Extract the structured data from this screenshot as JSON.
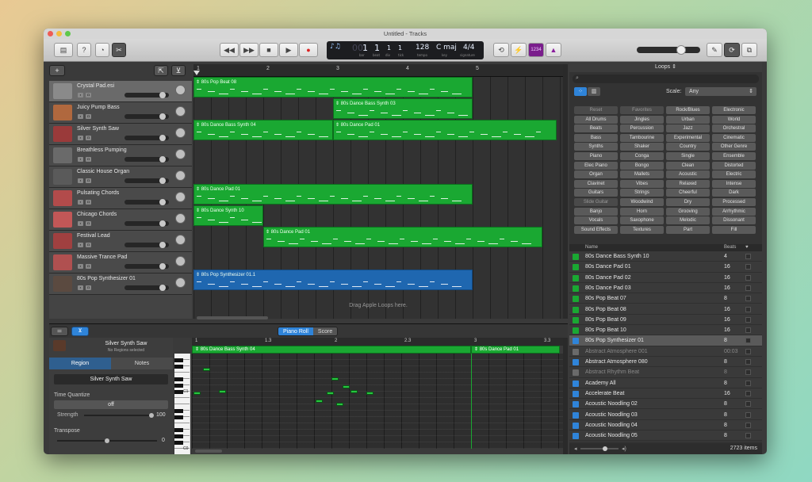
{
  "window": {
    "title": "Untitled - Tracks"
  },
  "lcd": {
    "bar": "1",
    "bar_label": "bar",
    "beat": "1",
    "beat_label": "beat",
    "div": "1",
    "div_label": "div",
    "tick": "1",
    "tick_label": "tick",
    "tempo": "128",
    "tempo_label": "tempo",
    "key": "C maj",
    "key_label": "key",
    "signature": "4/4",
    "signature_label": "signature",
    "counter": "1234"
  },
  "tracks": [
    {
      "name": "Crystal Pad.esi",
      "selected": true
    },
    {
      "name": "Juicy Pump Bass"
    },
    {
      "name": "Silver Synth Saw"
    },
    {
      "name": "Breathless Pumping"
    },
    {
      "name": "Classic House Organ"
    },
    {
      "name": "Pulsating Chords"
    },
    {
      "name": "Chicago Chords"
    },
    {
      "name": "Festival Lead"
    },
    {
      "name": "Massive Trance Pad"
    },
    {
      "name": "80s Pop Synthesizer 01"
    }
  ],
  "ruler": [
    "1",
    "2",
    "3",
    "4",
    "5"
  ],
  "regions": [
    {
      "label": "80s Pop Beat 08",
      "row": 0,
      "start": 0,
      "len": 4
    },
    {
      "label": "80s Dance Bass Synth 03",
      "row": 1,
      "start": 2,
      "len": 2
    },
    {
      "label": "80s Dance Bass Synth 04",
      "row": 2,
      "start": 0,
      "len": 2
    },
    {
      "label": "80s Dance Pad 01",
      "row": 2,
      "start": 2,
      "len": 3.2
    },
    {
      "label": "80s Dance Pad 01",
      "row": 5,
      "start": 0,
      "len": 4
    },
    {
      "label": "80s Dance Synth 10",
      "row": 6,
      "start": 0,
      "len": 1
    },
    {
      "label": "80s Dance Pad 01",
      "row": 7,
      "start": 1,
      "len": 4
    },
    {
      "label": "80s Pop Synthesizer 01.1",
      "row": 9,
      "start": 0,
      "len": 4,
      "color": "blue"
    }
  ],
  "drop_hint": "Drag Apple Loops here.",
  "editor": {
    "tabs": [
      "Piano Roll",
      "Score"
    ],
    "track_name": "Silver Synth Saw",
    "sub": "No Regions selected",
    "inspector_tabs": [
      "Region",
      "Notes"
    ],
    "region_name": "Silver Synth Saw",
    "time_quantize_label": "Time Quantize",
    "time_quantize_value": "off",
    "strength_label": "Strength",
    "strength_value": "100",
    "transpose_label": "Transpose",
    "transpose_value": "0",
    "ruler": [
      "1",
      "1.3",
      "2",
      "2.3",
      "3",
      "3.3"
    ],
    "regions": [
      "80s Dance Bass Synth 04",
      "80s Dance Pad 01"
    ],
    "key_labels": [
      "C1",
      "C0"
    ]
  },
  "loops": {
    "title": "Loops",
    "scale_label": "Scale:",
    "scale_value": "Any",
    "filters": [
      [
        "Reset",
        "Favorites",
        "Rock/Blues",
        "Electronic"
      ],
      [
        "All Drums",
        "Jingles",
        "Urban",
        "World"
      ],
      [
        "Beats",
        "Percussion",
        "Jazz",
        "Orchestral"
      ],
      [
        "Bass",
        "Tambourine",
        "Experimental",
        "Cinematic"
      ],
      [
        "Synths",
        "Shaker",
        "Country",
        "Other Genre"
      ],
      [
        "Piano",
        "Conga",
        "Single",
        "Ensemble"
      ],
      [
        "Elec Piano",
        "Bongo",
        "Clean",
        "Distorted"
      ],
      [
        "Organ",
        "Mallets",
        "Acoustic",
        "Electric"
      ],
      [
        "Clavinet",
        "Vibes",
        "Relaxed",
        "Intense"
      ],
      [
        "Guitars",
        "Strings",
        "Cheerful",
        "Dark"
      ],
      [
        "Slide Guitar",
        "Woodwind",
        "Dry",
        "Processed"
      ],
      [
        "Banjo",
        "Horn",
        "Grooving",
        "Arrhythmic"
      ],
      [
        "Vocals",
        "Saxophone",
        "Melodic",
        "Dissonant"
      ],
      [
        "Sound Effects",
        "Textures",
        "Part",
        "Fill"
      ]
    ],
    "col_name": "Name",
    "col_beats": "Beats",
    "results": [
      {
        "name": "80s Dance Bass Synth 10",
        "beats": "4",
        "kind": "green"
      },
      {
        "name": "80s Dance Pad 01",
        "beats": "16",
        "kind": "green"
      },
      {
        "name": "80s Dance Pad 02",
        "beats": "16",
        "kind": "green"
      },
      {
        "name": "80s Dance Pad 03",
        "beats": "16",
        "kind": "green"
      },
      {
        "name": "80s Pop Beat 07",
        "beats": "8",
        "kind": "green"
      },
      {
        "name": "80s Pop Beat 08",
        "beats": "16",
        "kind": "green"
      },
      {
        "name": "80s Pop Beat 09",
        "beats": "16",
        "kind": "green"
      },
      {
        "name": "80s Pop Beat 10",
        "beats": "16",
        "kind": "green"
      },
      {
        "name": "80s Pop Synthesizer 01",
        "beats": "8",
        "kind": "blue",
        "selected": true
      },
      {
        "name": "Abstract Atmosphere 001",
        "beats": "00:03",
        "kind": "gray",
        "dim": true
      },
      {
        "name": "Abstract Atmosphere 080",
        "beats": "8",
        "kind": "blue"
      },
      {
        "name": "Abstract Rhythm Beat",
        "beats": "8",
        "kind": "gray",
        "dim": true
      },
      {
        "name": "Academy All",
        "beats": "8",
        "kind": "blue"
      },
      {
        "name": "Accelerate Beat",
        "beats": "16",
        "kind": "blue"
      },
      {
        "name": "Acoustic Noodling 02",
        "beats": "8",
        "kind": "blue"
      },
      {
        "name": "Acoustic Noodling 03",
        "beats": "8",
        "kind": "blue"
      },
      {
        "name": "Acoustic Noodling 04",
        "beats": "8",
        "kind": "blue"
      },
      {
        "name": "Acoustic Noodling 05",
        "beats": "8",
        "kind": "blue"
      }
    ],
    "count": "2723 items"
  },
  "colors": {
    "green": "#1aa832",
    "blue": "#1f67b0",
    "accent": "#2f84d9"
  }
}
